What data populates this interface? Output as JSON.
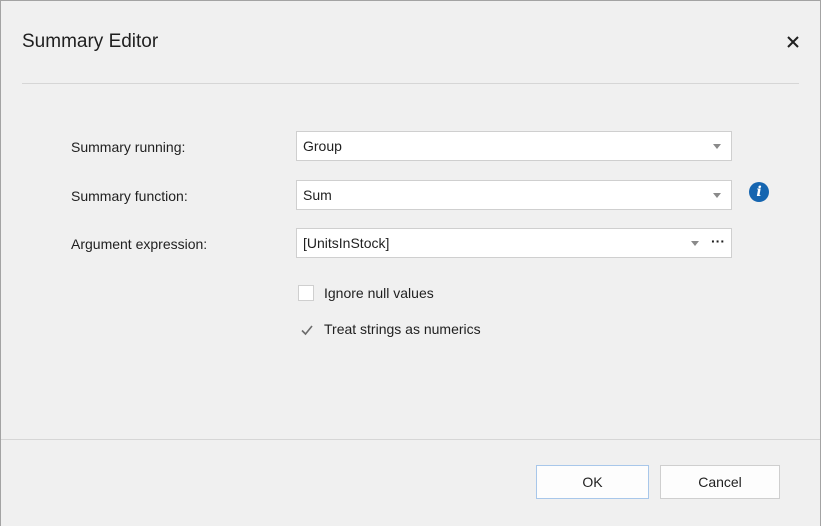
{
  "dialog": {
    "title": "Summary Editor",
    "close_icon": "close-icon"
  },
  "form": {
    "summary_running": {
      "label": "Summary running:",
      "value": "Group"
    },
    "summary_function": {
      "label": "Summary function:",
      "value": "Sum",
      "info_icon": "info-icon"
    },
    "argument_expression": {
      "label": "Argument expression:",
      "value": "[UnitsInStock]",
      "ellipsis": "···"
    },
    "ignore_null": {
      "label": "Ignore null values",
      "checked": false
    },
    "treat_strings": {
      "label": "Treat strings as numerics",
      "checked": true
    }
  },
  "buttons": {
    "ok": "OK",
    "cancel": "Cancel"
  },
  "colors": {
    "info_icon_bg": "#1565b0",
    "ok_border": "#a8c7ea",
    "background": "#f0f0f0"
  }
}
